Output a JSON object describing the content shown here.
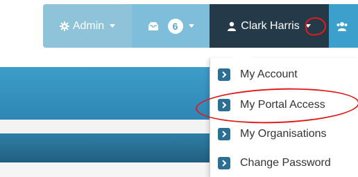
{
  "navbar": {
    "admin_label": "Admin",
    "inbox_count": "6",
    "user_name": "Clark Harris"
  },
  "dropdown": {
    "items": [
      {
        "label": "My Account"
      },
      {
        "label": "My Portal Access"
      },
      {
        "label": "My Organisations"
      },
      {
        "label": "Change Password"
      }
    ]
  },
  "annotations": {
    "highlight_color": "#e21a1a"
  },
  "icons": {
    "admin": "gear-icon",
    "inbox": "inbox-icon",
    "user": "user-icon",
    "group": "users-icon",
    "dropdown_item": "chevron-right-icon"
  },
  "colors": {
    "admin_bg": "#8ec3da",
    "inbox_bg": "#7fbedb",
    "user_bg": "#253a48",
    "group_bg": "#3da0cc",
    "item_icon_bg": "#2d6f93"
  }
}
